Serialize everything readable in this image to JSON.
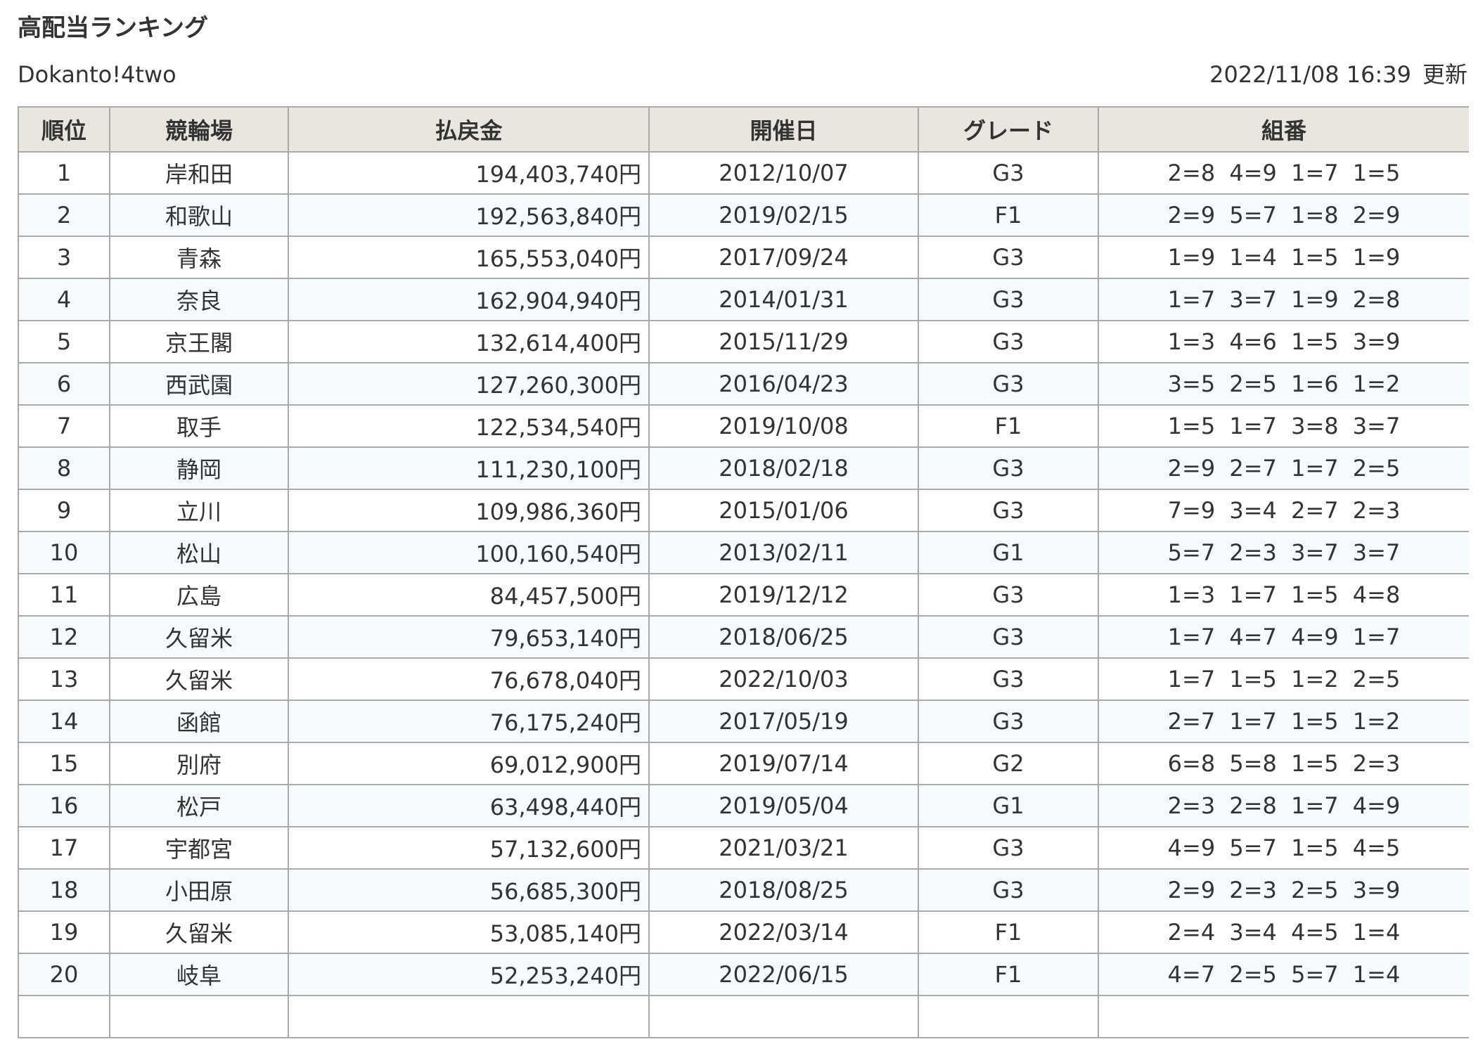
{
  "header": {
    "title": "高配当ランキング",
    "site_name": "Dokanto!4two",
    "updated_datetime": "2022/11/08 16:39",
    "updated_label": "更新"
  },
  "table": {
    "columns": [
      "順位",
      "競輪場",
      "払戻金",
      "開催日",
      "グレード",
      "組番"
    ],
    "rows": [
      {
        "rank": "1",
        "venue": "岸和田",
        "payout": "194,403,740円",
        "date": "2012/10/07",
        "grade": "G3",
        "combo": "2=8 4=9 1=7 1=5"
      },
      {
        "rank": "2",
        "venue": "和歌山",
        "payout": "192,563,840円",
        "date": "2019/02/15",
        "grade": "F1",
        "combo": "2=9 5=7 1=8 2=9"
      },
      {
        "rank": "3",
        "venue": "青森",
        "payout": "165,553,040円",
        "date": "2017/09/24",
        "grade": "G3",
        "combo": "1=9 1=4 1=5 1=9"
      },
      {
        "rank": "4",
        "venue": "奈良",
        "payout": "162,904,940円",
        "date": "2014/01/31",
        "grade": "G3",
        "combo": "1=7 3=7 1=9 2=8"
      },
      {
        "rank": "5",
        "venue": "京王閣",
        "payout": "132,614,400円",
        "date": "2015/11/29",
        "grade": "G3",
        "combo": "1=3 4=6 1=5 3=9"
      },
      {
        "rank": "6",
        "venue": "西武園",
        "payout": "127,260,300円",
        "date": "2016/04/23",
        "grade": "G3",
        "combo": "3=5 2=5 1=6 1=2"
      },
      {
        "rank": "7",
        "venue": "取手",
        "payout": "122,534,540円",
        "date": "2019/10/08",
        "grade": "F1",
        "combo": "1=5 1=7 3=8 3=7"
      },
      {
        "rank": "8",
        "venue": "静岡",
        "payout": "111,230,100円",
        "date": "2018/02/18",
        "grade": "G3",
        "combo": "2=9 2=7 1=7 2=5"
      },
      {
        "rank": "9",
        "venue": "立川",
        "payout": "109,986,360円",
        "date": "2015/01/06",
        "grade": "G3",
        "combo": "7=9 3=4 2=7 2=3"
      },
      {
        "rank": "10",
        "venue": "松山",
        "payout": "100,160,540円",
        "date": "2013/02/11",
        "grade": "G1",
        "combo": "5=7 2=3 3=7 3=7"
      },
      {
        "rank": "11",
        "venue": "広島",
        "payout": "84,457,500円",
        "date": "2019/12/12",
        "grade": "G3",
        "combo": "1=3 1=7 1=5 4=8"
      },
      {
        "rank": "12",
        "venue": "久留米",
        "payout": "79,653,140円",
        "date": "2018/06/25",
        "grade": "G3",
        "combo": "1=7 4=7 4=9 1=7"
      },
      {
        "rank": "13",
        "venue": "久留米",
        "payout": "76,678,040円",
        "date": "2022/10/03",
        "grade": "G3",
        "combo": "1=7 1=5 1=2 2=5"
      },
      {
        "rank": "14",
        "venue": "函館",
        "payout": "76,175,240円",
        "date": "2017/05/19",
        "grade": "G3",
        "combo": "2=7 1=7 1=5 1=2"
      },
      {
        "rank": "15",
        "venue": "別府",
        "payout": "69,012,900円",
        "date": "2019/07/14",
        "grade": "G2",
        "combo": "6=8 5=8 1=5 2=3"
      },
      {
        "rank": "16",
        "venue": "松戸",
        "payout": "63,498,440円",
        "date": "2019/05/04",
        "grade": "G1",
        "combo": "2=3 2=8 1=7 4=9"
      },
      {
        "rank": "17",
        "venue": "宇都宮",
        "payout": "57,132,600円",
        "date": "2021/03/21",
        "grade": "G3",
        "combo": "4=9 5=7 1=5 4=5"
      },
      {
        "rank": "18",
        "venue": "小田原",
        "payout": "56,685,300円",
        "date": "2018/08/25",
        "grade": "G3",
        "combo": "2=9 2=3 2=5 3=9"
      },
      {
        "rank": "19",
        "venue": "久留米",
        "payout": "53,085,140円",
        "date": "2022/03/14",
        "grade": "F1",
        "combo": "2=4 3=4 4=5 1=4"
      },
      {
        "rank": "20",
        "venue": "岐阜",
        "payout": "52,253,240円",
        "date": "2022/06/15",
        "grade": "F1",
        "combo": "4=7 2=5 5=7 1=4"
      },
      {
        "rank": "",
        "venue": "",
        "payout": "",
        "date": "",
        "grade": "",
        "combo": ""
      }
    ]
  }
}
